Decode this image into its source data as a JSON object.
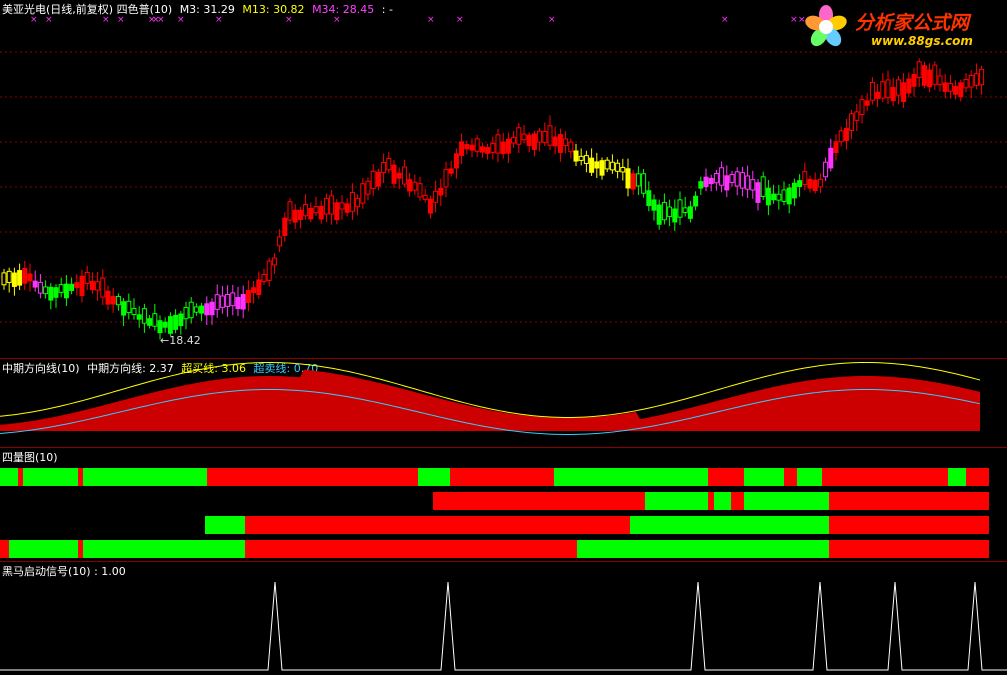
{
  "main_panel": {
    "stock_title": "美亚光电(日线,前复权)",
    "indicator_name": "四色普(10)",
    "ma_values": [
      {
        "label": "M3: 31.29",
        "color": "#ffffff"
      },
      {
        "label": "M13: 30.82",
        "color": "#ffff00"
      },
      {
        "label": "M34: 28.45",
        "color": "#ff44ff"
      },
      {
        "label": ": -",
        "color": "#ffffff"
      }
    ],
    "low_marker": "←18.42"
  },
  "logo": {
    "title": "分析家公式网",
    "url": "www.88gs.com"
  },
  "direction_panel": {
    "title": "中期方向线(10)",
    "line_label": "中期方向线: 2.37",
    "buy_label": "超买线: 3.06",
    "sell_label": "超卖线: 0.70",
    "colors": {
      "line": "#ffffff",
      "buy": "#ffff00",
      "sell": "#33ccff"
    }
  },
  "four_bar_panel": {
    "title": "四量图(10)"
  },
  "signal_panel": {
    "title": "黑马启动信号(10) : 1.00"
  },
  "colors": {
    "up_red": "#ff0000",
    "down_green": "#00ff00",
    "yellow": "#ffff00",
    "magenta": "#ff33ff",
    "grid": "#8a0000"
  }
}
